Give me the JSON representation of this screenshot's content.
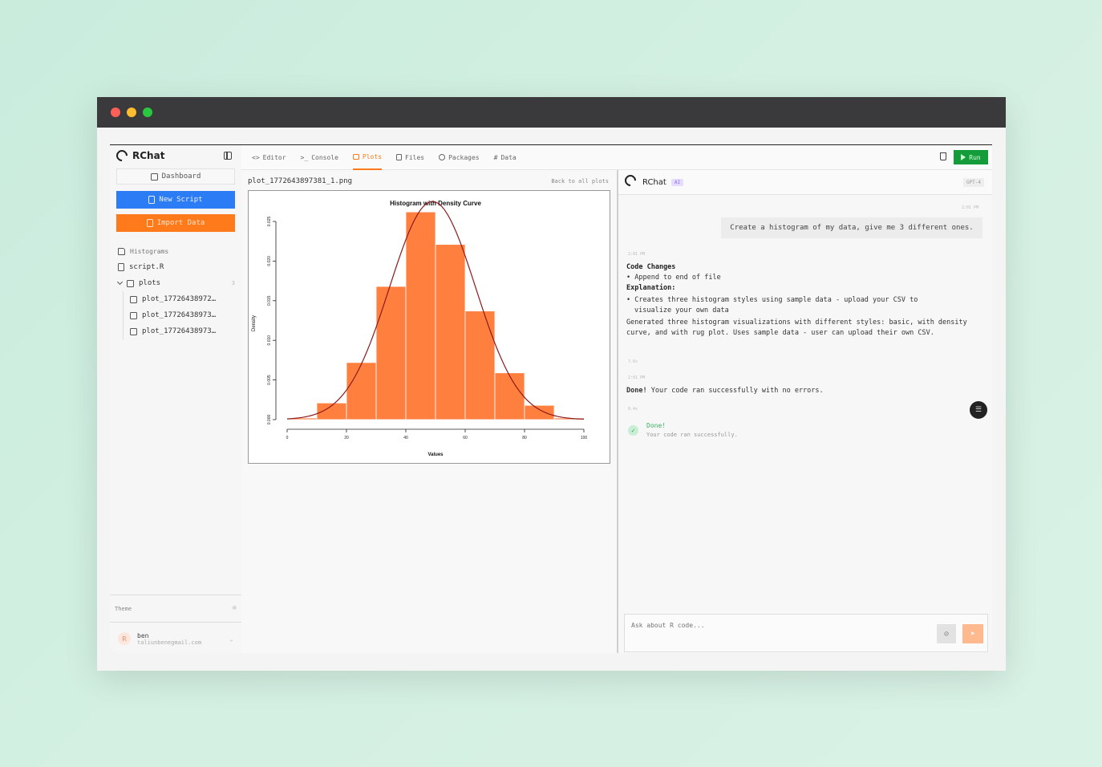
{
  "app": {
    "brand": "RChat"
  },
  "sidebar": {
    "dashboard_label": "Dashboard",
    "new_script_label": "New Script",
    "import_label": "Import Data",
    "folder_label": "Histograms",
    "file_label": "script.R",
    "plots_label": "plots",
    "plots_count": "3",
    "plot_files": [
      "plot_17726438972…",
      "plot_17726438973…",
      "plot_17726438973…"
    ],
    "theme_label": "Theme",
    "user_name": "ben",
    "user_email": "taliunbenegmail.com"
  },
  "tabs": [
    {
      "label": "Editor",
      "icon": "code-icon"
    },
    {
      "label": "Console",
      "icon": "terminal-icon"
    },
    {
      "label": "Plots",
      "icon": "chart-icon",
      "active": true
    },
    {
      "label": "Files",
      "icon": "files-icon"
    },
    {
      "label": "Packages",
      "icon": "package-icon"
    },
    {
      "label": "Data",
      "icon": "grid-icon"
    }
  ],
  "run_label": "Run",
  "plot_panel": {
    "filename": "plot_1772643897381_1.png",
    "back_label": "Back to all plots"
  },
  "chart_data": {
    "type": "bar",
    "title": "Histogram with Density Curve",
    "xlabel": "Values",
    "ylabel": "Density",
    "xlim": [
      0,
      100
    ],
    "ylim": [
      0,
      0.025
    ],
    "xticks": [
      "0",
      "20",
      "40",
      "60",
      "80",
      "100"
    ],
    "yticks": [
      "0.000",
      "0.005",
      "0.010",
      "0.015",
      "0.020",
      "0.025"
    ],
    "bins": [
      0,
      10,
      20,
      30,
      40,
      50,
      60,
      70,
      80,
      90,
      100
    ],
    "values": [
      0.0002,
      0.0021,
      0.0072,
      0.0168,
      0.0262,
      0.0221,
      0.0137,
      0.0059,
      0.0018,
      0.0002
    ],
    "density_curve": {
      "mean": 49,
      "sd": 14.5
    },
    "bar_color": "#ff7f3f",
    "curve_color": "#8b1a1a"
  },
  "chat": {
    "title": "RChat",
    "badge": "AI",
    "model": "GPT-4",
    "user_time": "2:01 PM",
    "user_message": "Create a histogram of my data, give me 3 different ones.",
    "assistant_time": "2:01 PM",
    "code_changes_label": "Code Changes",
    "code_change_item": "• Append to end of file",
    "explanation_label": "Explanation:",
    "explanation_item_1": "• Creates three histogram styles using sample data - upload your CSV to",
    "explanation_item_2": "visualize your own data",
    "summary": "Generated three histogram visualizations with different styles: basic, with density curve, and with rug plot. Uses sample data - user can upload their own CSV.",
    "meta_1": "7.6s",
    "done_time": "2:01 PM",
    "done_bold": "Done!",
    "done_rest": " Your code ran successfully with no errors.",
    "meta_2": "0.4s",
    "status_title": "Done!",
    "status_sub": "Your code ran successfully.",
    "input_placeholder": "Ask about R code..."
  }
}
